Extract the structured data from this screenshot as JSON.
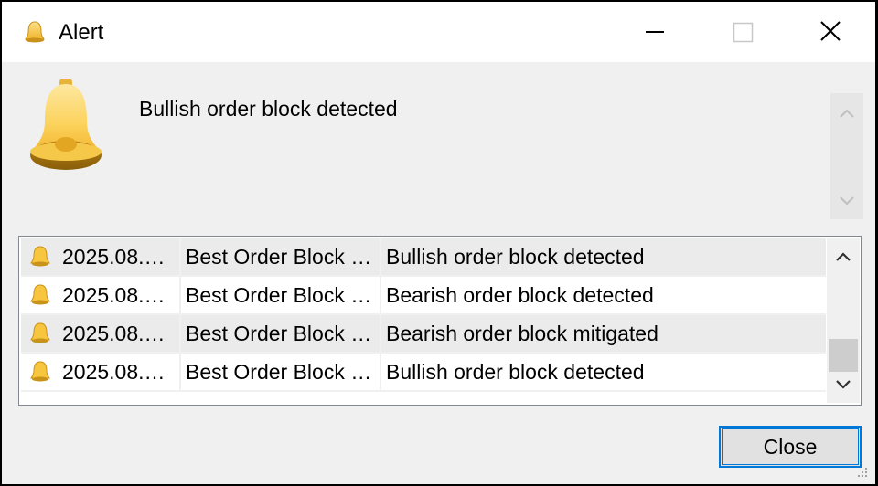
{
  "window": {
    "title": "Alert",
    "colors": {
      "bell_light": "#fcd25b",
      "bell_dark": "#d19b1a",
      "accent": "#0078d7"
    }
  },
  "message": {
    "text": "Bullish order block detected"
  },
  "alerts": [
    {
      "time": "2025.08.…",
      "expert": "Best Order Block …",
      "message": "Bullish order block detected"
    },
    {
      "time": "2025.08.…",
      "expert": "Best Order Block …",
      "message": "Bearish order block detected"
    },
    {
      "time": "2025.08.…",
      "expert": "Best Order Block …",
      "message": "Bearish order block mitigated"
    },
    {
      "time": "2025.08.…",
      "expert": "Best Order Block …",
      "message": "Bullish order block detected"
    }
  ],
  "buttons": {
    "close_label": "Close"
  },
  "icons": {
    "title": "bell-icon",
    "minimize": "minimize-icon",
    "maximize": "maximize-icon",
    "close": "close-icon"
  }
}
